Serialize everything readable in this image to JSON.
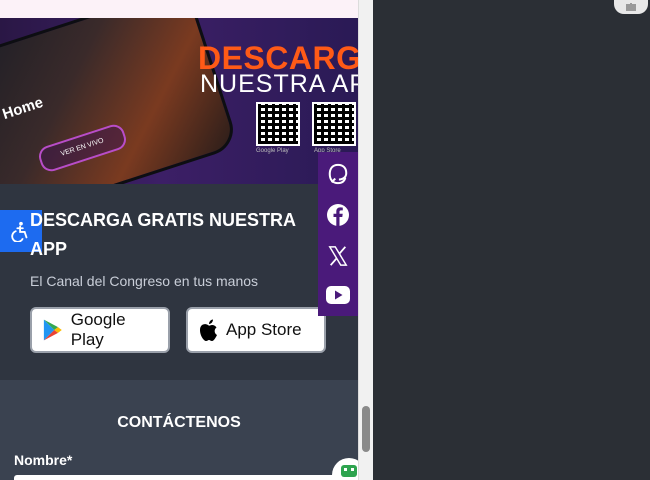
{
  "banner": {
    "title": "DESCARGA",
    "subtitle": "NUESTRA AP",
    "phone_home": "Home",
    "phone_live": "VER EN VIVO",
    "store_small_1": "Google Play",
    "store_small_2": "App Store"
  },
  "app_section": {
    "title": "DESCARGA GRATIS NUESTRA APP",
    "tagline": "El Canal del Congreso en tus manos",
    "google_play_label": "Google Play",
    "app_store_label": "App Store"
  },
  "contact": {
    "title": "CONTÁCTENOS",
    "name_label": "Nombre*"
  },
  "social": [
    "threads-icon",
    "facebook-icon",
    "x-icon",
    "youtube-icon"
  ],
  "colors": {
    "accent_orange": "#ff5a17",
    "social_bar": "#4a1a7a",
    "a11y_blue": "#1d6bf0",
    "page_dark": "#2f3540"
  }
}
